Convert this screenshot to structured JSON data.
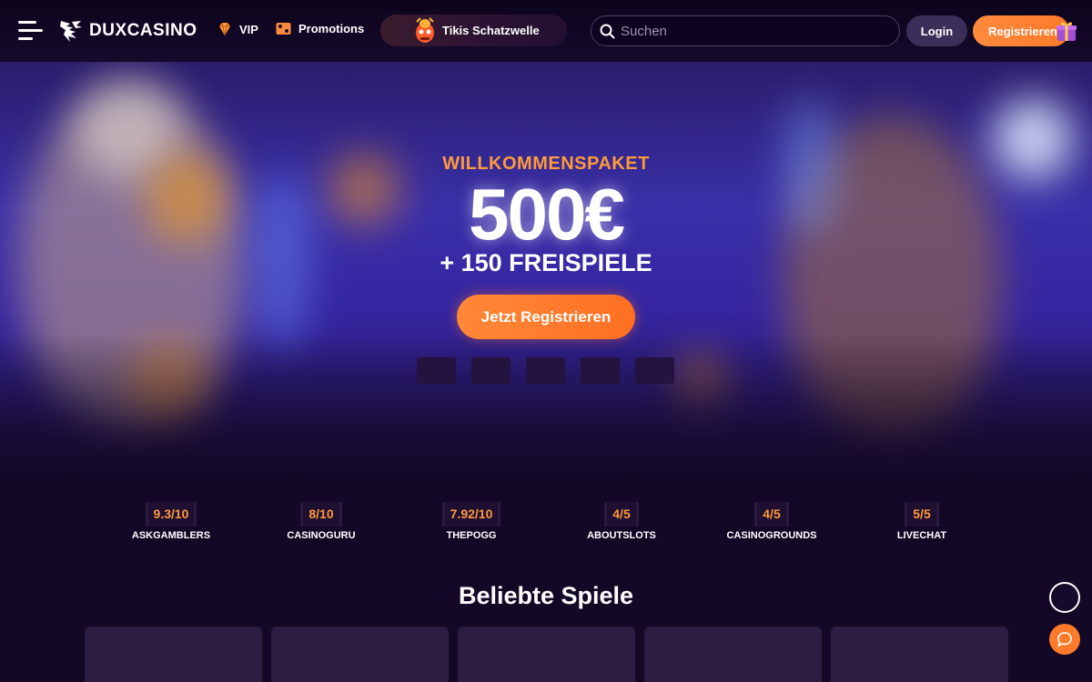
{
  "header": {
    "logo_text": "DUXCASINO",
    "nav": [
      {
        "label": "VIP",
        "icon": "diamond-icon"
      },
      {
        "label": "Promotions",
        "icon": "ticket-icon"
      }
    ],
    "promo_pill_label": "Tikis Schatzwelle",
    "search_placeholder": "Suchen",
    "login_label": "Login",
    "register_label": "Registrieren"
  },
  "hero": {
    "subtitle": "WILLKOMMENSPAKET",
    "amount": "500€",
    "spins": "+ 150 FREISPIELE",
    "cta_label": "Jetzt Registrieren",
    "slide_count": 5
  },
  "ratings": [
    {
      "score": "9.3/10",
      "source": "ASKGAMBLERS"
    },
    {
      "score": "8/10",
      "source": "CASINOGURU"
    },
    {
      "score": "7.92/10",
      "source": "THEPOGG"
    },
    {
      "score": "4/5",
      "source": "ABOUTSLOTS"
    },
    {
      "score": "4/5",
      "source": "CASINOGROUNDS"
    },
    {
      "score": "5/5",
      "source": "LIVECHAT"
    }
  ],
  "popular": {
    "title": "Beliebte Spiele"
  },
  "colors": {
    "accent": "#ff8a3d",
    "background": "#130826",
    "hero_blue": "#3a2fa8"
  }
}
